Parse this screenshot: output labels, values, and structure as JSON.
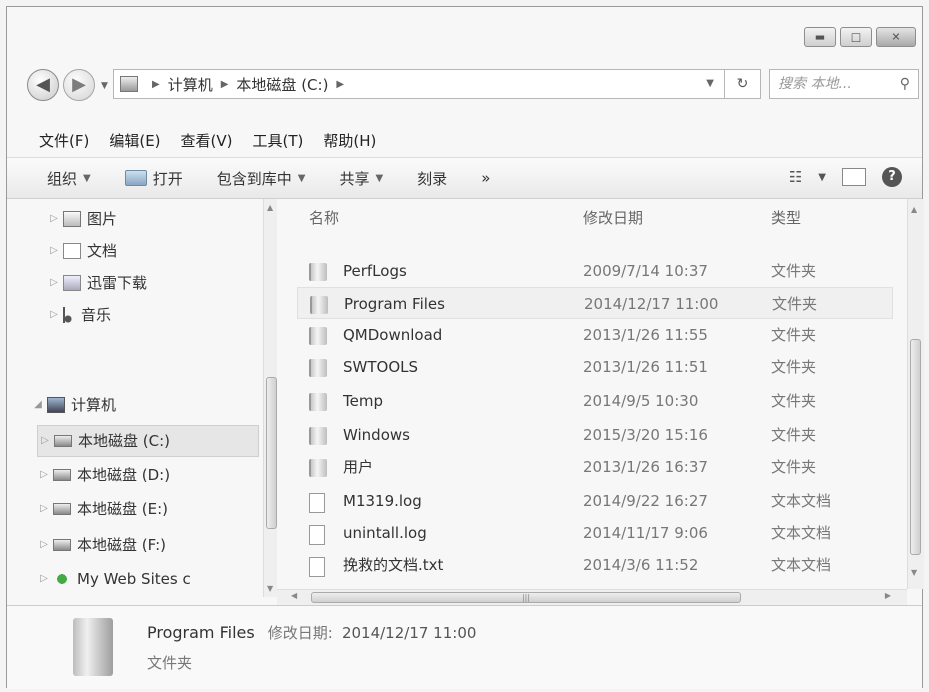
{
  "window": {
    "search_placeholder": "搜索 本地..."
  },
  "address": {
    "crumbs": [
      "计算机",
      "本地磁盘 (C:)"
    ]
  },
  "menu": [
    "文件(F)",
    "编辑(E)",
    "查看(V)",
    "工具(T)",
    "帮助(H)"
  ],
  "toolbar": {
    "organize": "组织",
    "open": "打开",
    "include_library": "包含到库中",
    "share": "共享",
    "burn": "刻录",
    "more": "»"
  },
  "nav": {
    "items": [
      {
        "label": "图片",
        "icon": "pictures-icon"
      },
      {
        "label": "文档",
        "icon": "documents-icon"
      },
      {
        "label": "迅雷下载",
        "icon": "downloads-icon"
      },
      {
        "label": "音乐",
        "icon": "music-icon"
      },
      {
        "label": "计算机",
        "icon": "computer-icon"
      },
      {
        "label": "本地磁盘 (C:)",
        "icon": "drive-icon"
      },
      {
        "label": "本地磁盘 (D:)",
        "icon": "drive-icon"
      },
      {
        "label": "本地磁盘 (E:)",
        "icon": "drive-icon"
      },
      {
        "label": "本地磁盘 (F:)",
        "icon": "drive-icon"
      },
      {
        "label": "My Web Sites c",
        "icon": "web-sites-icon"
      }
    ]
  },
  "columns": {
    "name": "名称",
    "modified": "修改日期",
    "type": "类型"
  },
  "files": [
    {
      "name": "PerfLogs",
      "date": "2009/7/14 10:37",
      "type": "文件夹",
      "kind": "folder"
    },
    {
      "name": "Program Files",
      "date": "2014/12/17 11:00",
      "type": "文件夹",
      "kind": "folder"
    },
    {
      "name": "QMDownload",
      "date": "2013/1/26 11:55",
      "type": "文件夹",
      "kind": "folder"
    },
    {
      "name": "SWTOOLS",
      "date": "2013/1/26 11:51",
      "type": "文件夹",
      "kind": "folder"
    },
    {
      "name": "Temp",
      "date": "2014/9/5 10:30",
      "type": "文件夹",
      "kind": "folder"
    },
    {
      "name": "Windows",
      "date": "2015/3/20 15:16",
      "type": "文件夹",
      "kind": "folder"
    },
    {
      "name": "用户",
      "date": "2013/1/26 16:37",
      "type": "文件夹",
      "kind": "folder"
    },
    {
      "name": "M1319.log",
      "date": "2014/9/22 16:27",
      "type": "文本文档",
      "kind": "file"
    },
    {
      "name": "unintall.log",
      "date": "2014/11/17 9:06",
      "type": "文本文档",
      "kind": "file"
    },
    {
      "name": "挽救的文档.txt",
      "date": "2014/3/6 11:52",
      "type": "文本文档",
      "kind": "file"
    }
  ],
  "details": {
    "name": "Program Files",
    "modified_label": "修改日期:",
    "modified_value": "2014/12/17 11:00",
    "type": "文件夹"
  }
}
